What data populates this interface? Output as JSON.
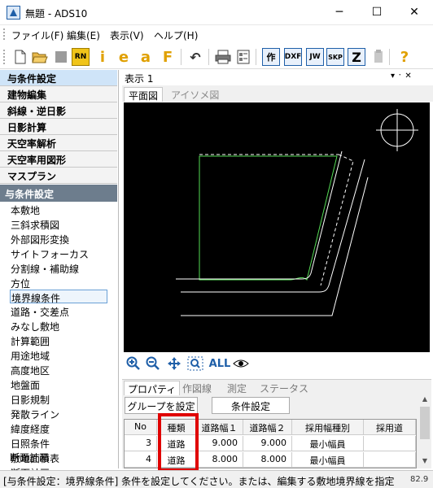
{
  "window": {
    "title": "無題 - ADS10",
    "min": "─",
    "max": "☐",
    "close": "✕"
  },
  "menu": [
    "ファイル(F)",
    "編集(E)",
    "表示(V)",
    "ヘルプ(H)"
  ],
  "toolbar": {
    "rn": "RN",
    "i": "i",
    "e": "e",
    "a": "a",
    "f": "F",
    "saku": "作",
    "dxf": "DXF",
    "jw": "JW",
    "skp": "SKP",
    "z": "Z",
    "help": "?"
  },
  "categories": [
    "与条件設定",
    "建物編集",
    "斜線・逆日影",
    "日影計算",
    "天空率解析",
    "天空率用図形",
    "マスプラン"
  ],
  "active_category": "与条件設定",
  "section_header": "与条件設定",
  "items": [
    "本敷地",
    "三斜求積図",
    "外部図形変換",
    "サイトフォーカス",
    "分割線・補助線",
    "方位",
    "境界線条件",
    "道路・交差点",
    "みなし敷地",
    "計算範囲",
    "用途地域",
    "高度地区",
    "地盤面",
    "日影規制",
    "発散ライン",
    "緯度経度",
    "日照条件",
    "敷地面積表",
    "断面計画"
  ],
  "selected_item": "境界線条件",
  "view": {
    "title": "表示 1",
    "pin": "▾ ᛫ ✕",
    "tabs": [
      "平面図",
      "アイソメ図"
    ]
  },
  "zoom": {
    "all": "ALL"
  },
  "props": {
    "tabs": [
      "プロパティ",
      "作図線",
      "測定",
      "ステータス"
    ],
    "group_btn": "グループを設定",
    "cond_btn": "条件設定",
    "columns": [
      "No",
      "種類",
      "道路幅１",
      "道路幅２",
      "採用幅種別",
      "採用道"
    ],
    "rows": [
      {
        "no": "3",
        "type": "道路",
        "w1": "9.000",
        "w2": "9.000",
        "kind": "最小幅員"
      },
      {
        "no": "4",
        "type": "道路",
        "w1": "8.000",
        "w2": "8.000",
        "kind": "最小幅員"
      }
    ]
  },
  "status": {
    "text": "[与条件設定：境界線条件] 条件を設定してください。または、編集する敷地境界線を指定",
    "right": "82.9"
  },
  "colors": {
    "accent": "#1f5fa8",
    "highlight": "#e00000",
    "site_line": "#55dd55"
  }
}
